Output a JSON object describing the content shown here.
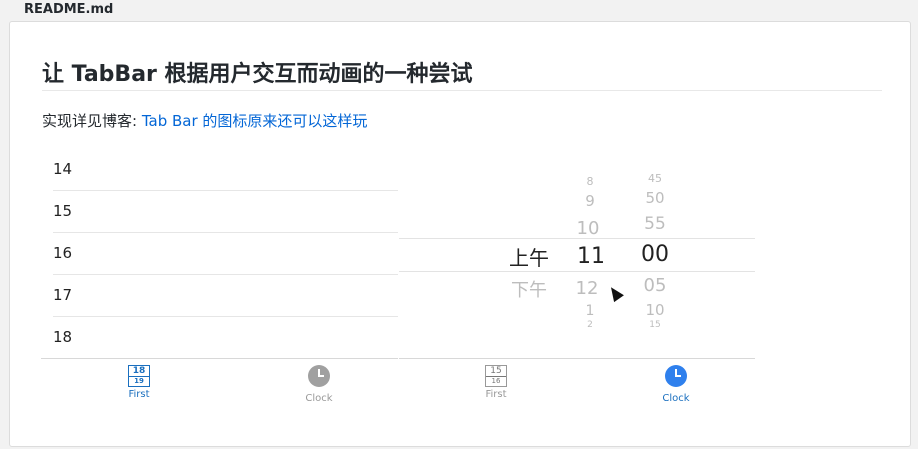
{
  "file": {
    "name": "README.md"
  },
  "article": {
    "title": "让 TabBar 根据用户交互而动画的一种尝试",
    "desc_prefix": "实现详见博客: ",
    "desc_link": "Tab Bar 的图标原来还可以这样玩"
  },
  "screen1": {
    "rows": [
      "14",
      "15",
      "16",
      "17",
      "18"
    ],
    "tabs": [
      {
        "label": "First",
        "icon": "calendar-icon",
        "num_top": "18",
        "num_bottom": "19",
        "active": true
      },
      {
        "label": "Clock",
        "icon": "clock-icon",
        "active": false
      }
    ]
  },
  "screen2": {
    "picker": {
      "ampm": [
        "上午",
        "下午"
      ],
      "hours": [
        "8",
        "9",
        "10",
        "11",
        "12",
        "1",
        "2"
      ],
      "minutes": [
        "45",
        "50",
        "55",
        "00",
        "05",
        "10",
        "15"
      ]
    },
    "tabs": [
      {
        "label": "First",
        "icon": "calendar-icon",
        "num_top": "15",
        "num_bottom": "16",
        "active": false
      },
      {
        "label": "Clock",
        "icon": "clock-icon",
        "active": true
      }
    ]
  },
  "colors": {
    "link": "#0366d6",
    "accent": "#2f80ed"
  }
}
